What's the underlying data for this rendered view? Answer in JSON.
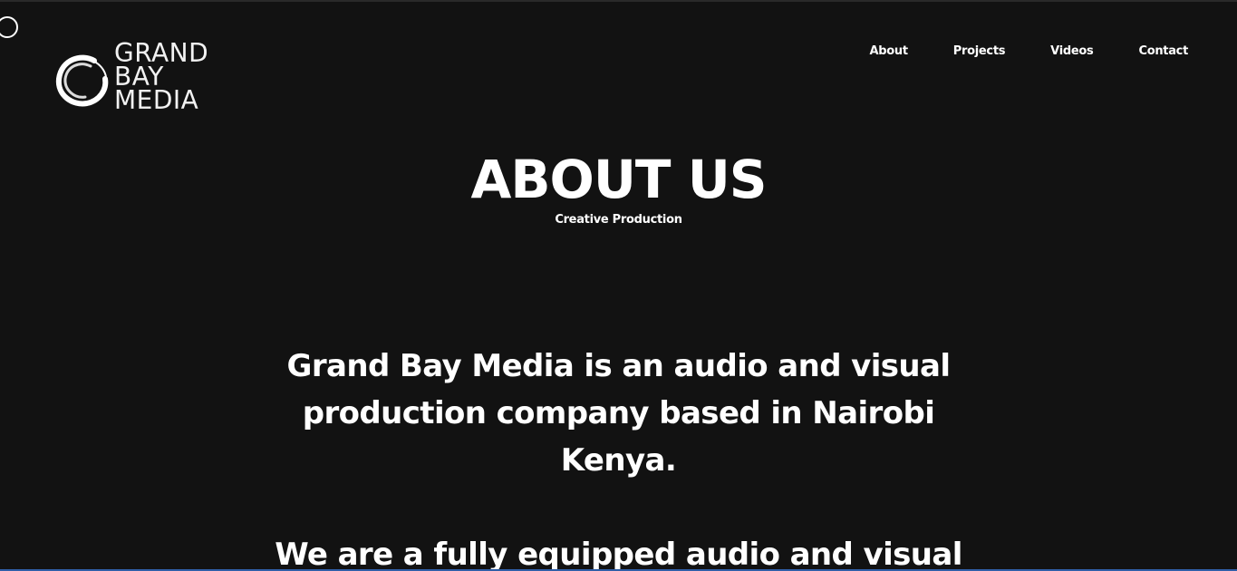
{
  "brand": {
    "line1": "GRAND",
    "line2": "BAY",
    "line3": "MEDIA"
  },
  "nav": {
    "items": [
      {
        "label": "About"
      },
      {
        "label": "Projects"
      },
      {
        "label": "Videos"
      },
      {
        "label": "Contact"
      }
    ]
  },
  "hero": {
    "title": "ABOUT US",
    "subtitle": "Creative Production"
  },
  "content": {
    "paragraph1": "Grand Bay Media is an audio and visual production company based in Nairobi Kenya.",
    "paragraph2": "We are a fully equipped audio and visual"
  },
  "colors": {
    "background": "#121212",
    "text": "#ffffff"
  },
  "icons": {
    "logo_mark": "brush-circle-icon",
    "cursor": "cursor-ring-icon"
  }
}
